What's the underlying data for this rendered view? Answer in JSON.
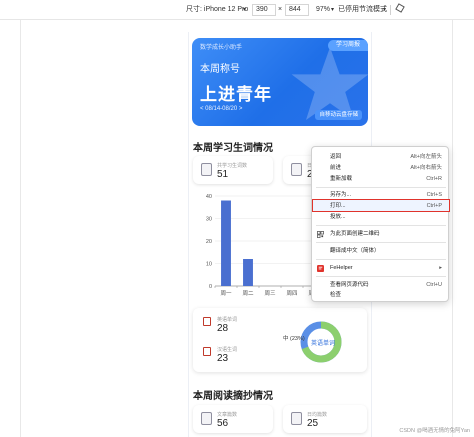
{
  "devtools": {
    "size_label": "尺寸: iPhone 12 Pro",
    "width": "390",
    "times": "×",
    "height": "844",
    "zoom": "97%",
    "throttle": "已停用节流模式"
  },
  "phone": {
    "hero": {
      "assistant": "数学成长小助手",
      "report_button": "学习周报",
      "week_label": "本周称号",
      "title": "上进青年",
      "date_range": "< 08/14-08/20 >",
      "cloud_button": "自移动云盘存储"
    },
    "section1": {
      "title": "本周学习生词情况",
      "card1": {
        "label": "共学习生词数",
        "value": "51"
      },
      "card2": {
        "label": "日",
        "value": "25"
      }
    },
    "section2": {
      "card1": {
        "label": "英语单词",
        "value": "28"
      },
      "card2": {
        "label": "汉语生词",
        "value": "23"
      },
      "donut_label": "中 (23%)",
      "donut_center": "英语单词"
    },
    "section3": {
      "title": "本周阅读摘抄情况",
      "card1": {
        "label": "文章篇数",
        "value": "56"
      },
      "card2": {
        "label": "日均篇数",
        "value": "25"
      }
    }
  },
  "chart_data": {
    "type": "bar",
    "categories": [
      "周一",
      "周二",
      "周三",
      "周四",
      "周五"
    ],
    "values": [
      38,
      12,
      0,
      0,
      0
    ],
    "ylim": [
      0,
      40
    ],
    "yticks": [
      "40",
      "30",
      "20",
      "10",
      "0"
    ],
    "colors": {
      "bar": "#4a6fd0"
    }
  },
  "context_menu": {
    "items": [
      {
        "label": "返回",
        "shortcut": "Alt+向左箭头"
      },
      {
        "label": "前进",
        "shortcut": "Alt+向右箭头"
      },
      {
        "label": "重新加载",
        "shortcut": "Ctrl+R"
      },
      {
        "label": "另存为...",
        "shortcut": "Ctrl+S"
      },
      {
        "label": "打印...",
        "shortcut": "Ctrl+P"
      },
      {
        "label": "投放...",
        "shortcut": ""
      },
      {
        "label": "为此页面创建二维码",
        "shortcut": ""
      },
      {
        "label": "翻译成中文（简体）",
        "shortcut": ""
      },
      {
        "label": "FeHelper",
        "shortcut": "▸"
      },
      {
        "label": "查看网页源代码",
        "shortcut": "Ctrl+U"
      },
      {
        "label": "检查",
        "shortcut": ""
      }
    ]
  },
  "watermark": "CSDN @喝酒无情的兔阿Yan"
}
